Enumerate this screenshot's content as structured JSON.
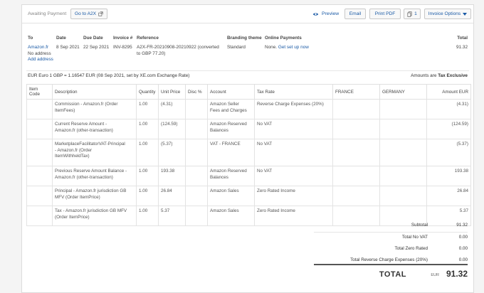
{
  "toolbar": {
    "status": "Awaiting Payment",
    "goto_label": "Go to A2X",
    "preview_label": "Preview",
    "email_label": "Email",
    "print_label": "Print PDF",
    "copies_count": "1",
    "options_label": "Invoice Options"
  },
  "head": {
    "to_label": "To",
    "to_name": "Amazon.fr",
    "to_address": "No address",
    "add_address": "Add address",
    "date_label": "Date",
    "date_value": "8 Sep 2021",
    "due_label": "Due Date",
    "due_value": "22 Sep 2021",
    "invno_label": "Invoice #",
    "invno_value": "INV-8295",
    "ref_label": "Reference",
    "ref_value_1": "A2X-FR-20210908-20210922 (converted",
    "ref_value_2": "to GBP 77.20)",
    "branding_label": "Branding theme",
    "branding_value": "Standard",
    "online_label": "Online Payments",
    "online_value": "None.",
    "online_link": "Get set up now",
    "total_label": "Total",
    "total_value": "91.32"
  },
  "rate_line": "EUR Euro 1 GBP = 1.16547 EUR (08 Sep 2021, set by XE.com Exchange Rate)",
  "amounts_are_prefix": "Amounts are",
  "amounts_are_value": "Tax Exclusive",
  "columns": {
    "item_code": "Item Code",
    "description": "Description",
    "quantity": "Quantity",
    "unit_price": "Unit Price",
    "disc": "Disc %",
    "account": "Account",
    "tax_rate": "Tax Rate",
    "france": "FRANCE",
    "germany": "GERMANY",
    "amount": "Amount EUR"
  },
  "rows": [
    {
      "desc": [
        "Commission - Amazon.fr (Order",
        "ItemFees)"
      ],
      "qty": "1.00",
      "price": "(4.31)",
      "account": [
        "Amazon Seller",
        "Fees and Charges"
      ],
      "tax": "Reverse Charge Expenses (20%)",
      "amount": "(4.31)"
    },
    {
      "desc": [
        "Current Reserve Amount -",
        "Amazon.fr (other-transaction)"
      ],
      "qty": "1.00",
      "price": "(124.59)",
      "account": [
        "Amazon Reserved",
        "Balances"
      ],
      "tax": "No VAT",
      "amount": "(124.59)"
    },
    {
      "desc": [
        "MarketplaceFacilitatorVAT-Principal",
        "- Amazon.fr (Order",
        "ItemWithheldTax)"
      ],
      "qty": "1.00",
      "price": "(5.37)",
      "account": [
        "VAT - FRANCE"
      ],
      "tax": "No VAT",
      "amount": "(5.37)"
    },
    {
      "desc": [
        "Previous Reserve Amount Balance -",
        "Amazon.fr (other-transaction)"
      ],
      "qty": "1.00",
      "price": "193.38",
      "account": [
        "Amazon Reserved",
        "Balances"
      ],
      "tax": "No VAT",
      "amount": "193.38"
    },
    {
      "desc": [
        "Principal - Amazon.fr jurisdiction GB",
        "MFV (Order ItemPrice)"
      ],
      "qty": "1.00",
      "price": "26.84",
      "account": [
        "Amazon Sales"
      ],
      "tax": "Zero Rated Income",
      "amount": "26.84"
    },
    {
      "desc": [
        "Tax - Amazon.fr jurisdiction GB MFV",
        "(Order ItemPrice)"
      ],
      "qty": "1.00",
      "price": "5.37",
      "account": [
        "Amazon Sales"
      ],
      "tax": "Zero Rated Income",
      "amount": "5.37"
    }
  ],
  "totals": {
    "subtotal_label": "Subtotal",
    "subtotal_value": "91.32",
    "novat_label": "Total No VAT",
    "novat_value": "0.00",
    "zero_label": "Total Zero Rated",
    "zero_value": "0.00",
    "reverse_label": "Total Reverse Charge Expenses (20%)",
    "reverse_value": "0.00",
    "total_label": "TOTAL",
    "currency": "EUR",
    "total_value": "91.32"
  },
  "colors": {
    "link": "#1a5aa6"
  },
  "icons": {
    "goto": "external-link-icon",
    "preview": "eye-icon",
    "copies": "copy-icon",
    "options": "caret-down-icon"
  }
}
